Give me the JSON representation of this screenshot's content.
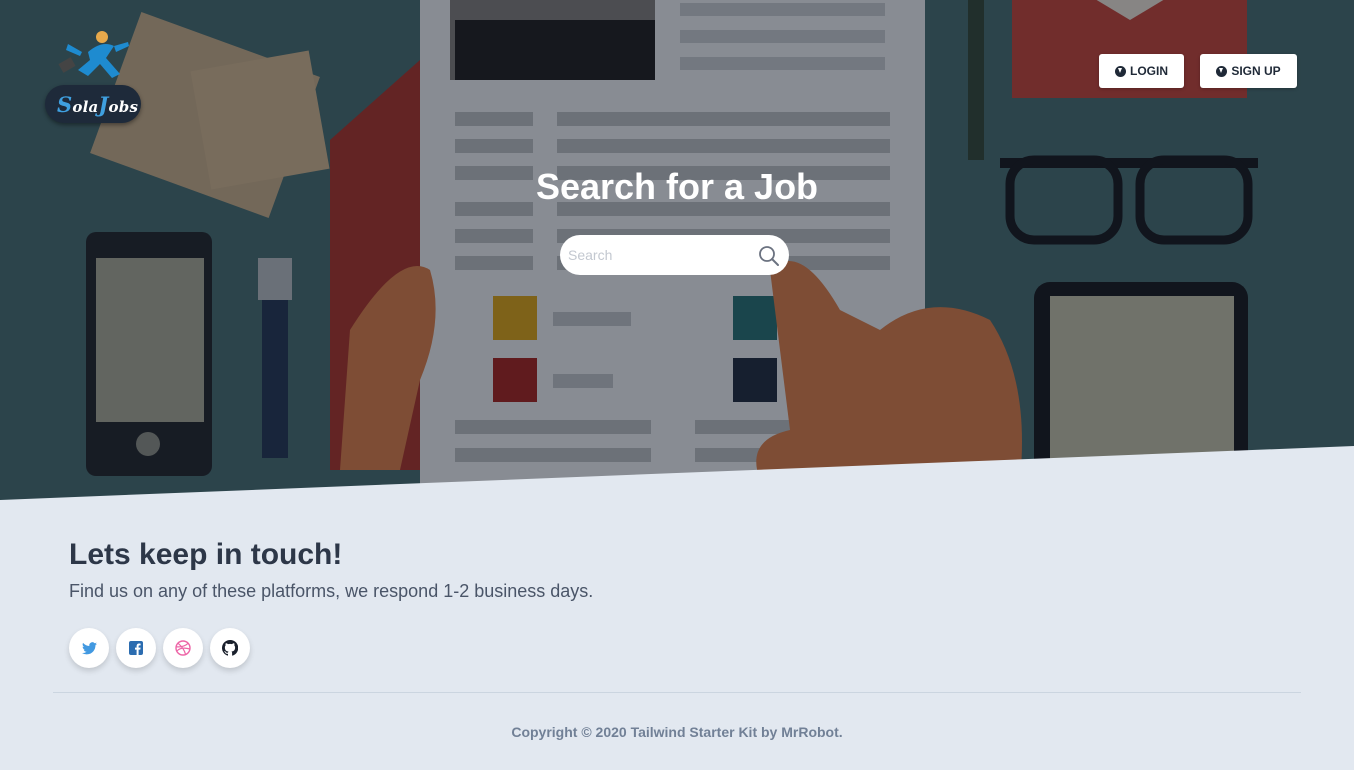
{
  "brand": {
    "logo_alt": "SolaJobs",
    "logo_s": "S",
    "logo_ola": "ola",
    "logo_j": "J",
    "logo_obs": "obs"
  },
  "header": {
    "login_label": "Login",
    "signup_label": "Sign Up"
  },
  "hero": {
    "title": "Search for a Job",
    "search_placeholder": "Search"
  },
  "contact": {
    "title": "Lets keep in touch!",
    "subtitle": "Find us on any of these platforms, we respond 1-2 business days.",
    "socials": [
      {
        "name": "twitter-icon",
        "color": "#4299e1"
      },
      {
        "name": "facebook-icon",
        "color": "#2b6cb0"
      },
      {
        "name": "dribbble-icon",
        "color": "#ed64a6"
      },
      {
        "name": "github-icon",
        "color": "#1a202c"
      }
    ]
  },
  "footer": {
    "copyright": "Copyright © 2020 Tailwind Starter Kit by MrRobot."
  },
  "colors": {
    "page_bg": "#e2e8f0",
    "heading": "#2d3748",
    "muted": "#718096"
  }
}
